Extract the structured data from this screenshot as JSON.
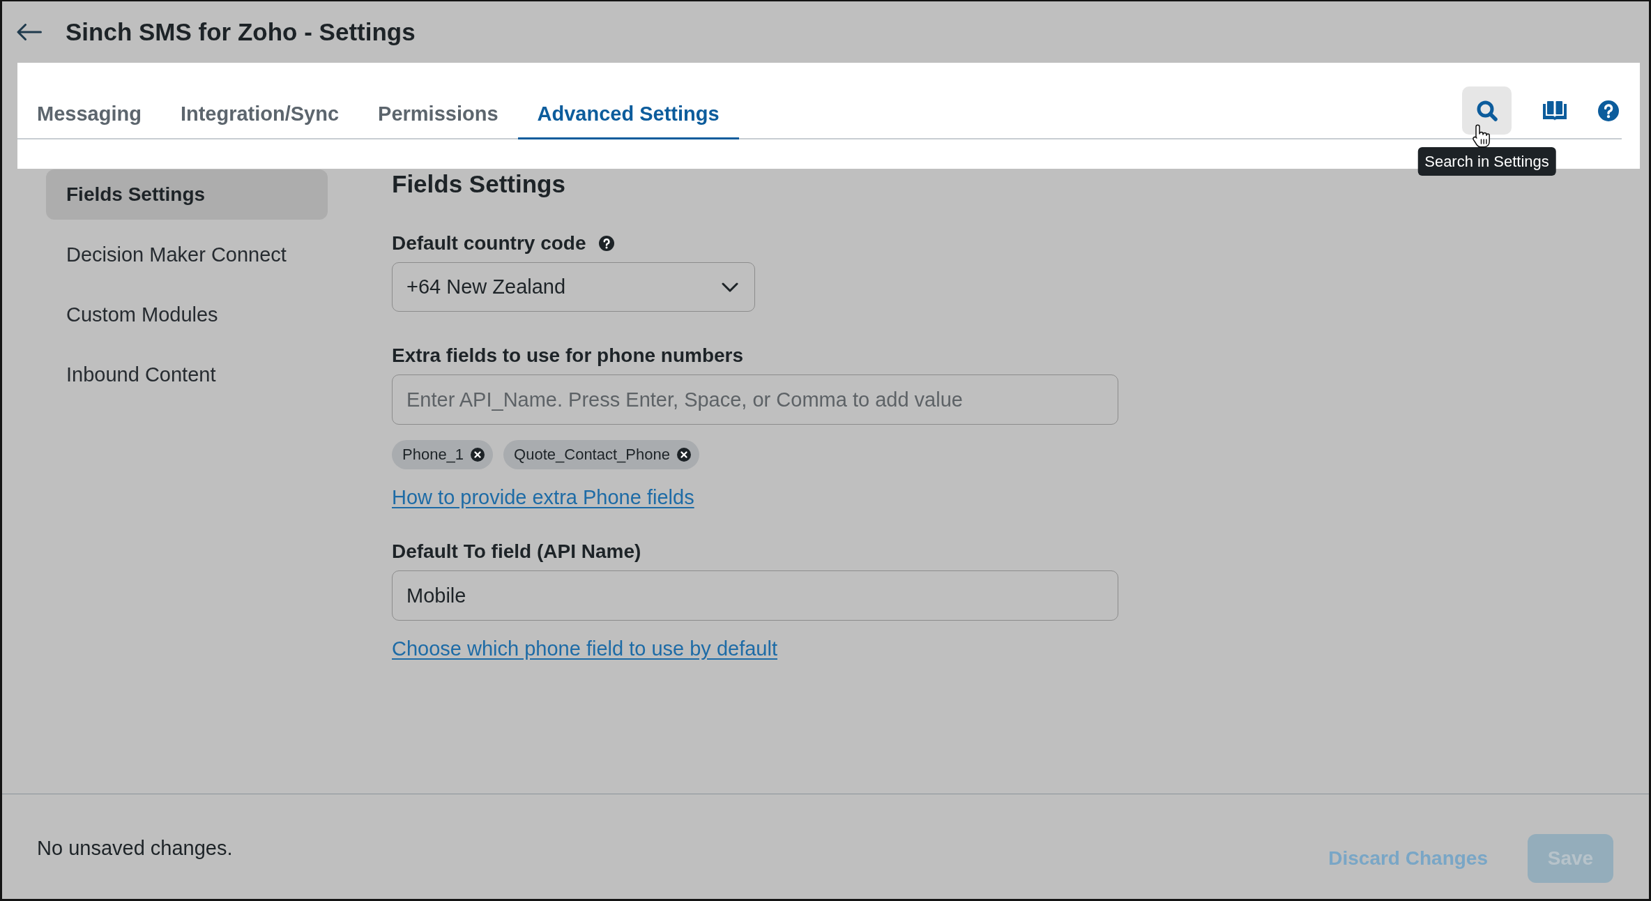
{
  "header": {
    "title": "Sinch SMS for Zoho - Settings"
  },
  "tabs": [
    {
      "label": "Messaging",
      "selected": false
    },
    {
      "label": "Integration/Sync",
      "selected": false
    },
    {
      "label": "Permissions",
      "selected": false
    },
    {
      "label": "Advanced Settings",
      "selected": true
    }
  ],
  "toolbar": {
    "buttons": [
      {
        "kind": "search",
        "hovered": true
      },
      {
        "kind": "guide",
        "hovered": false
      },
      {
        "kind": "help",
        "hovered": false
      }
    ],
    "tooltip": "Search in Settings"
  },
  "sidebar": {
    "items": [
      {
        "label": "Fields Settings",
        "selected": true
      },
      {
        "label": "Decision Maker Connect",
        "selected": false
      },
      {
        "label": "Custom Modules",
        "selected": false
      },
      {
        "label": "Inbound Content",
        "selected": false
      }
    ]
  },
  "section": {
    "title": "Fields Settings",
    "fields": [
      {
        "kind": "select",
        "label": "Default country code",
        "help": true,
        "value": "+64 New Zealand"
      },
      {
        "kind": "tags",
        "label": "Extra fields to use for phone numbers",
        "help": false,
        "placeholder": "Enter API_Name. Press Enter, Space, or Comma to add value",
        "tags": [
          "Phone_1",
          "Quote_Contact_Phone"
        ],
        "link": "How to provide extra Phone fields"
      },
      {
        "kind": "text",
        "label": "Default To field (API Name)",
        "help": false,
        "value": "Mobile",
        "link": "Choose which phone field to use by default"
      }
    ]
  },
  "footer": {
    "status": "No unsaved changes.",
    "buttons": [
      {
        "kind": "discard",
        "label": "Discard Changes",
        "disabled": true
      },
      {
        "kind": "save",
        "label": "Save",
        "disabled": true
      }
    ]
  }
}
